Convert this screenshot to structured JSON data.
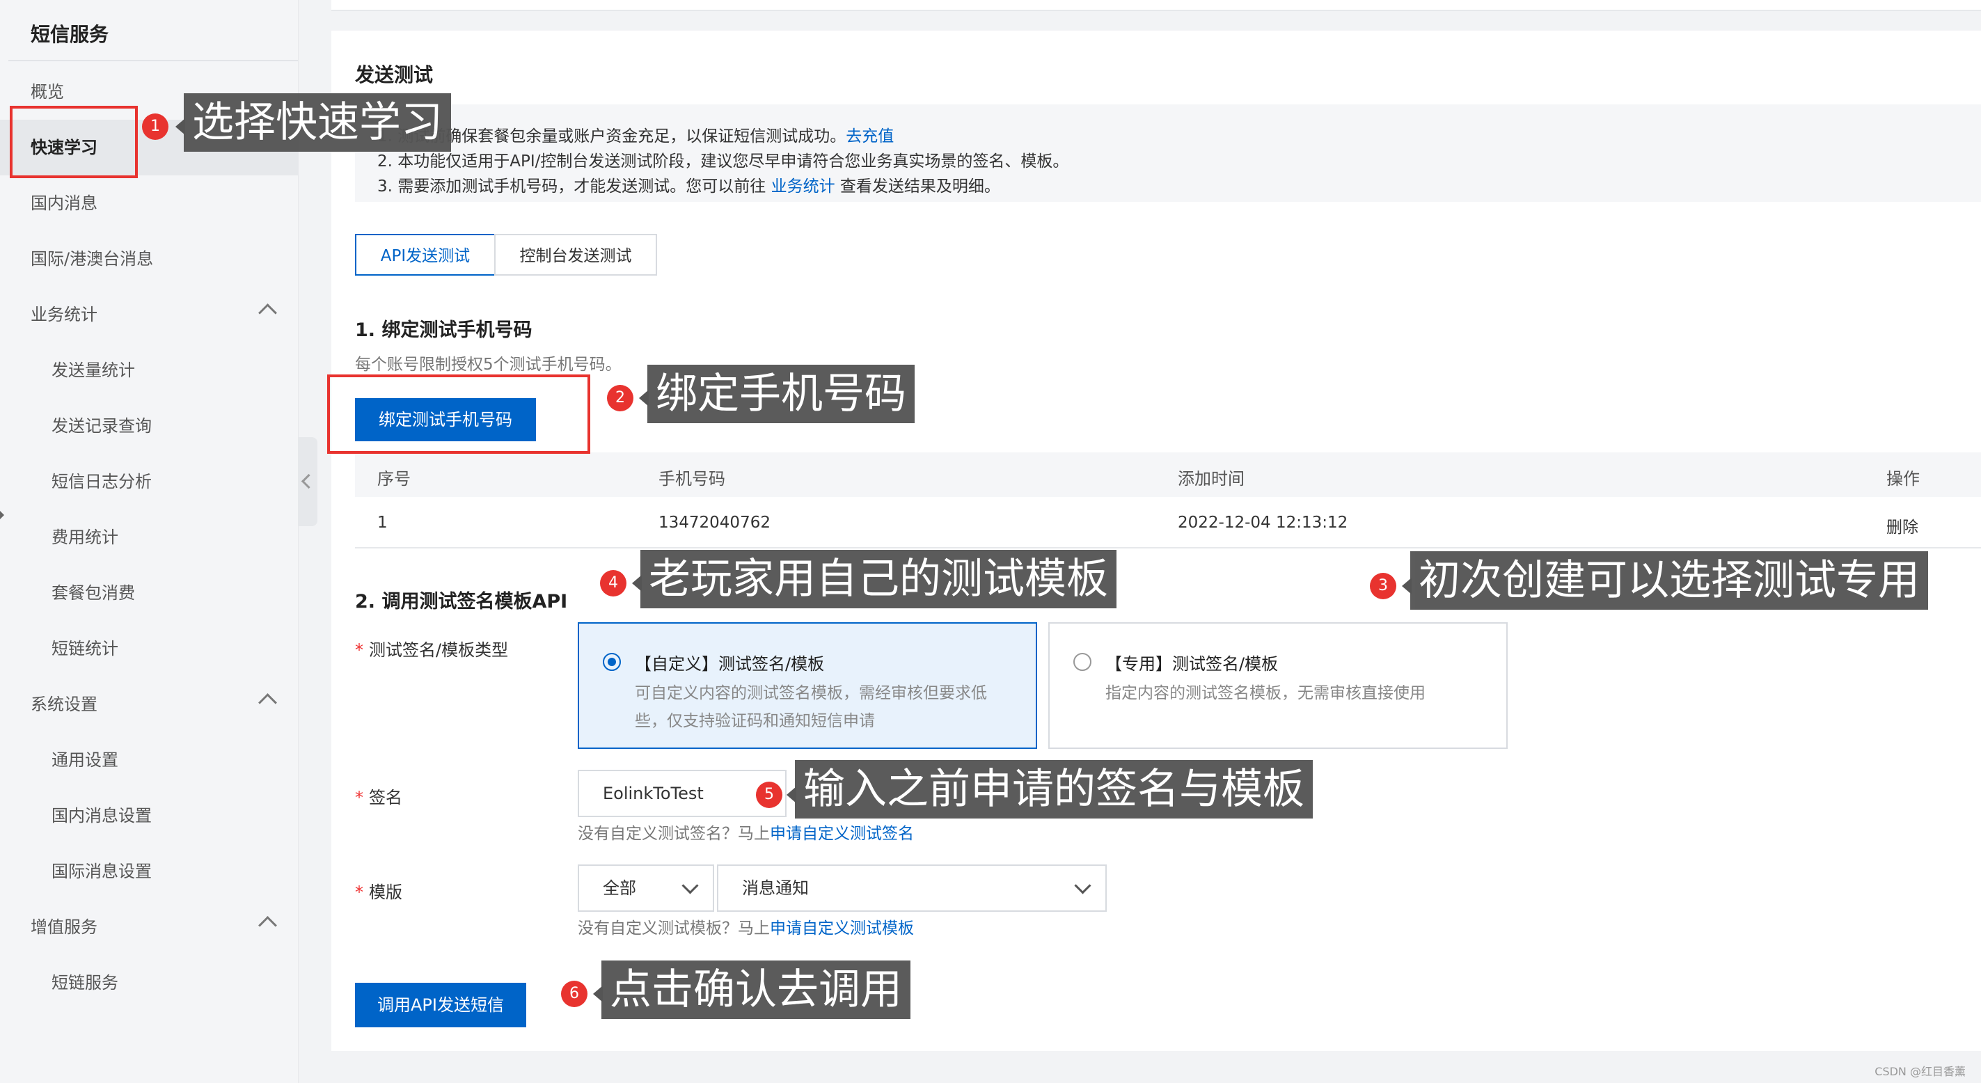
{
  "sidebar": {
    "title": "短信服务",
    "items": [
      {
        "label": "概览"
      },
      {
        "label": "快速学习"
      },
      {
        "label": "国内消息"
      },
      {
        "label": "国际/港澳台消息"
      },
      {
        "label": "业务统计"
      },
      {
        "label": "发送量统计"
      },
      {
        "label": "发送记录查询"
      },
      {
        "label": "短信日志分析"
      },
      {
        "label": "费用统计"
      },
      {
        "label": "套餐包消费"
      },
      {
        "label": "短链统计"
      },
      {
        "label": "系统设置"
      },
      {
        "label": "通用设置"
      },
      {
        "label": "国内消息设置"
      },
      {
        "label": "国际消息设置"
      },
      {
        "label": "增值服务"
      },
      {
        "label": "短链服务"
      }
    ]
  },
  "main": {
    "title": "发送测试",
    "notes": {
      "line1": "1. 测试前确保套餐包余量或账户资金充足，以保证短信测试成功。",
      "line1_link": "去充值",
      "line2": "2. 本功能仅适用于API/控制台发送测试阶段，建议您尽早申请符合您业务真实场景的签名、模板。",
      "line3": "3. 需要添加测试手机号码，才能发送测试。您可以前往",
      "line3_link": "业务统计",
      "line3_tail": "查看发送结果及明细。"
    },
    "tabs": [
      {
        "label": "API发送测试"
      },
      {
        "label": "控制台发送测试"
      }
    ],
    "bind_section": {
      "title": "1. 绑定测试手机号码",
      "desc": "每个账号限制授权5个测试手机号码。",
      "button": "绑定测试手机号码"
    },
    "table": {
      "headers": [
        "序号",
        "手机号码",
        "添加时间",
        "操作"
      ],
      "rows": [
        {
          "index": "1",
          "phone": "13472040762",
          "time": "2022-12-04 12:13:12",
          "action": "删除"
        }
      ]
    },
    "api_section": {
      "title": "2. 调用测试签名模板API",
      "type_label": "测试签名/模板类型",
      "custom_card": {
        "title": "【自定义】测试签名/模板",
        "desc1": "可自定义内容的测试签名模板，需经审核但要求低",
        "desc2": "些，仅支持验证码和通知短信申请"
      },
      "dedicated_card": {
        "title": "【专用】测试签名/模板",
        "desc": "指定内容的测试签名模板，无需审核直接使用"
      },
      "sign_label": "签名",
      "sign_value": "EolinkToTest",
      "sign_hint": "没有自定义测试签名？马上",
      "sign_hint_link": "申请自定义测试签名",
      "template_label": "模版",
      "template_scope": "全部",
      "template_value": "消息通知",
      "template_hint": "没有自定义测试模板？马上",
      "template_hint_link": "申请自定义测试模板",
      "submit_button": "调用API发送短信"
    }
  },
  "annotations": [
    {
      "num": "1",
      "text": "选择快速学习"
    },
    {
      "num": "2",
      "text": "绑定手机号码"
    },
    {
      "num": "3",
      "text": "初次创建可以选择测试专用"
    },
    {
      "num": "4",
      "text": "老玩家用自己的测试模板"
    },
    {
      "num": "5",
      "text": "输入之前申请的签名与模板"
    },
    {
      "num": "6",
      "text": "点击确认去调用"
    }
  ],
  "watermark": "CSDN @红目香薰",
  "colors": {
    "accent": "#0064c8",
    "annotation_red": "#e8332f",
    "bubble_bg": "#555555"
  }
}
